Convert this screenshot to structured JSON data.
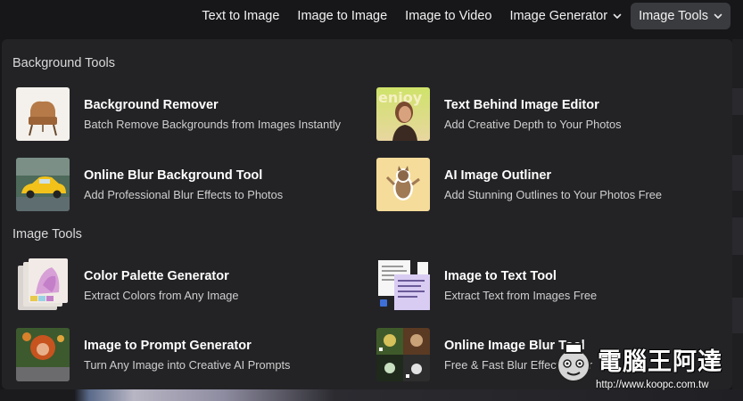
{
  "nav": {
    "items": [
      {
        "label": "Text to Image"
      },
      {
        "label": "Image to Image"
      },
      {
        "label": "Image to Video"
      },
      {
        "label": "Image Generator"
      },
      {
        "label": "Image Tools"
      }
    ]
  },
  "sections": {
    "background_tools": {
      "title": "Background Tools",
      "tools": [
        {
          "title": "Background Remover",
          "desc": "Batch Remove Backgrounds from Images Instantly"
        },
        {
          "title": "Text Behind Image Editor",
          "desc": "Add Creative Depth to Your Photos"
        },
        {
          "title": "Online Blur Background Tool",
          "desc": "Add Professional Blur Effects to Photos"
        },
        {
          "title": "AI Image Outliner",
          "desc": "Add Stunning Outlines to Your Photos Free"
        }
      ]
    },
    "image_tools": {
      "title": "Image Tools",
      "tools": [
        {
          "title": "Color Palette Generator",
          "desc": "Extract Colors from Any Image"
        },
        {
          "title": "Image to Text Tool",
          "desc": "Extract Text from Images Free"
        },
        {
          "title": "Image to Prompt Generator",
          "desc": "Turn Any Image into Creative AI Prompts"
        },
        {
          "title": "Online Image Blur Tool",
          "desc": "Free & Fast Blur Effect Editor"
        }
      ]
    }
  },
  "watermark": {
    "text": "電腦王阿達",
    "url": "http://www.koopc.com.tw"
  },
  "colors": {
    "background": "#17171a",
    "panel": "#232326",
    "active_nav": "#3a3b3f"
  }
}
